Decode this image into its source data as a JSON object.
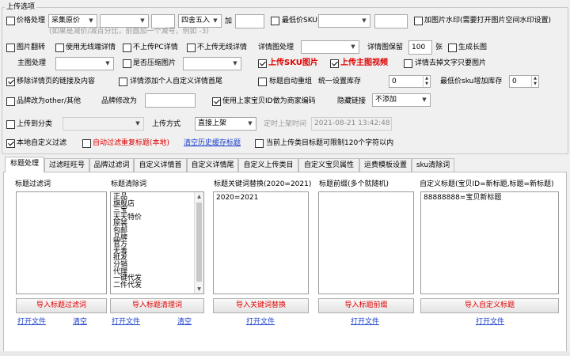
{
  "group_title": "上传选项",
  "row1": {
    "price_label": "价格处理",
    "price_mode": "采集原价",
    "round_mode": "四舍五入",
    "add_label": "加",
    "min_sku_label": "最低价SKU",
    "watermark_label": "加图片水印(需要打开图片空间水印设置)",
    "hint": "(如果是减价/减百分比，前面加一个减号，例如 -3)"
  },
  "row2": {
    "flip": "图片翻转",
    "no_wireless": "使用无线端详情",
    "no_pc": "不上传PC详情",
    "no_wireless_detail": "不上传无线详情",
    "detail_img_label": "详情图处理",
    "detail_keep_label": "详情图保留",
    "detail_keep_value": "100",
    "detail_keep_unit": "张",
    "long_img": "生成长图"
  },
  "row3": {
    "main_img_label": "主图处理",
    "compress": "是否压缩图片",
    "upload_sku_img": "上传SKU图片",
    "upload_main_video": "上传主图视频",
    "remove_text_only_img": "详情去掉文字只要图片"
  },
  "row4": {
    "remove_links": "移除详情页的链接及内容",
    "add_custom_detail": "详情添加个人自定义详情首尾",
    "auto_dedupe_title": "标题自动重组",
    "stock_label": "统一设置库存",
    "stock_value": "0",
    "min_sku_stock_label": "最低价sku增加库存",
    "min_sku_stock_value": "0"
  },
  "row5": {
    "brand_other": "品牌改为other/其他",
    "brand_change_label": "品牌修改为",
    "use_shop_id": "使用上家宝贝ID做为商家编码",
    "hide_link_label": "隐藏链接",
    "hide_link_value": "不添加"
  },
  "row6": {
    "upload_category": "上传到分类",
    "upload_method_label": "上传方式",
    "upload_method_value": "直接上架",
    "timed_label": "定时上架时间",
    "timed_value": "2021-08-21 13:42:48"
  },
  "row7": {
    "local_filter": "本地自定义过滤",
    "auto_filter_dup": "自动过滤重复标题(本地)",
    "clear_history": "清空历史缓存标题",
    "title_limit": "当前上传类目标题可限制120个字符以内"
  },
  "tabs": [
    {
      "label": "标题处理"
    },
    {
      "label": "过滤旺旺号"
    },
    {
      "label": "品牌过滤词"
    },
    {
      "label": "自定义详情首"
    },
    {
      "label": "自定义详情尾"
    },
    {
      "label": "自定义上传类目"
    },
    {
      "label": "自定义宝贝属性"
    },
    {
      "label": "运费模板设置"
    },
    {
      "label": "sku清除词"
    }
  ],
  "columns": [
    {
      "header": "标题过滤词",
      "button": "导入标题过滤词",
      "open": "打开文件",
      "clear": "清空",
      "lines": []
    },
    {
      "header": "标题清除词",
      "button": "导入标题清理词",
      "open": "打开文件",
      "clear": "清空",
      "lines": [
        "正品",
        "旗舰店",
        "三宝",
        "天天特价",
        "原装",
        "包邮",
        "品牌",
        "官方",
        "无毒",
        "批发",
        "分销",
        "代理",
        "一键代发",
        "二件代发"
      ]
    },
    {
      "header": "标题关键词替换(2020=2021)",
      "button": "导入关键词替换",
      "open": "打开文件",
      "lines": [
        "2020=2021"
      ]
    },
    {
      "header": "标题前缀(多个就随机)",
      "button": "导入标题前缀",
      "open": "打开文件",
      "lines": []
    },
    {
      "header": "自定义标题(宝贝ID=新标题,标题=新标题)",
      "button": "导入自定义标题",
      "open": "打开文件",
      "lines": [
        "88888888=宝贝新标题"
      ]
    }
  ],
  "icons": {
    "dropdown": "chevron-down-icon",
    "spin": "spinner-arrows-icon"
  },
  "colors": {
    "accent_red": "#e00000",
    "link_blue": "#1a3fcc"
  }
}
